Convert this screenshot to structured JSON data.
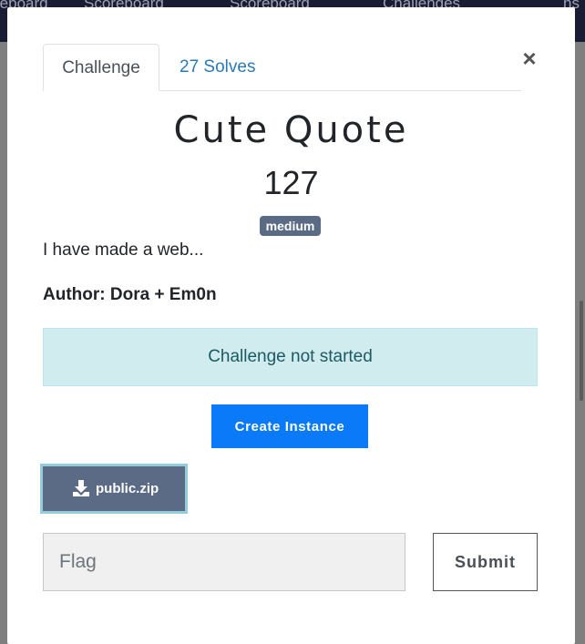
{
  "topnav": {
    "items": [
      "reboard",
      "Scoreboard",
      "Scoreboard",
      "Challenges",
      "ns"
    ]
  },
  "modal": {
    "tabs": [
      {
        "label": "Challenge",
        "active": true
      },
      {
        "label": "27 Solves",
        "active": false
      }
    ],
    "close_label": "×",
    "title": "Cute Quote",
    "points": "127",
    "difficulty": "medium",
    "description": "I have made a web...",
    "author": "Author: Dora + Em0n",
    "status_alert": "Challenge not started",
    "create_button": "Create Instance",
    "file": {
      "name": "public.zip",
      "icon": "download-icon"
    },
    "flag_input": {
      "placeholder": "Flag",
      "value": ""
    },
    "submit_button": "Submit"
  },
  "colors": {
    "primary": "#0a7af8",
    "badge": "#5b6b86",
    "alert_bg": "#d1ecef",
    "tab_link": "#2a7ab8",
    "nav_bg": "#1a1c33"
  }
}
